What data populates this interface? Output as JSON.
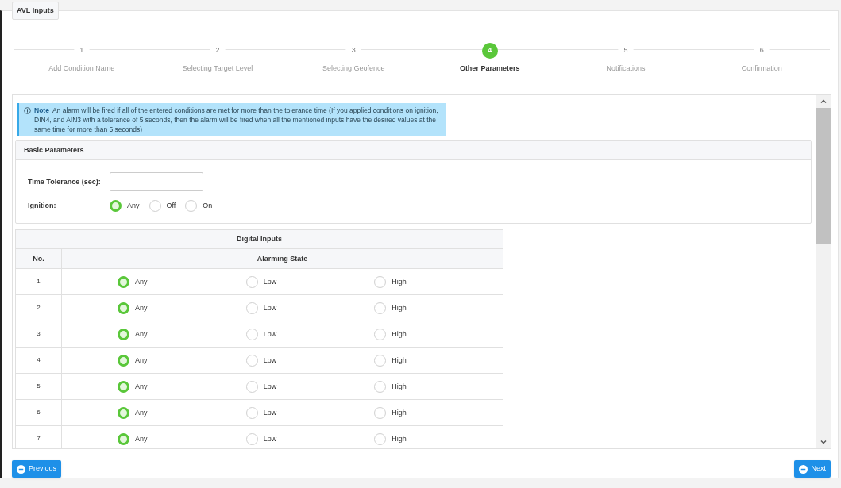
{
  "legend": "AVL Inputs",
  "steps": [
    {
      "number": "1",
      "label": "Add Condition Name",
      "selected": false
    },
    {
      "number": "2",
      "label": "Selecting Target Level",
      "selected": false
    },
    {
      "number": "3",
      "label": "Selecting Geofence",
      "selected": false
    },
    {
      "number": "4",
      "label": "Other Parameters",
      "selected": true
    },
    {
      "number": "5",
      "label": "Notifications",
      "selected": false
    },
    {
      "number": "6",
      "label": "Confirmation",
      "selected": false
    }
  ],
  "note": {
    "title": "Note",
    "text": "An alarm will be fired if all of the entered conditions are met for more than the tolerance time (If you applied conditions on ignition, DIN4, and AIN3 with a tolerance of 5 seconds, then the alarm will be fired when all the mentioned inputs have the desired values at the same time for more than 5 seconds)"
  },
  "basic": {
    "title": "Basic Parameters",
    "tolerance_label": "Time Tolerance (sec):",
    "ignition_label": "Ignition:",
    "ignition_options": [
      {
        "label": "Any",
        "selected": true
      },
      {
        "label": "Off",
        "selected": false
      },
      {
        "label": "On",
        "selected": false
      }
    ]
  },
  "digital": {
    "title": "Digital Inputs",
    "columns": [
      "No.",
      "Alarming State"
    ],
    "rows": [
      {
        "no": "1",
        "options": [
          {
            "label": "Any",
            "selected": true
          },
          {
            "label": "Low",
            "selected": false
          },
          {
            "label": "High",
            "selected": false
          }
        ]
      },
      {
        "no": "2",
        "options": [
          {
            "label": "Any",
            "selected": true
          },
          {
            "label": "Low",
            "selected": false
          },
          {
            "label": "High",
            "selected": false
          }
        ]
      },
      {
        "no": "3",
        "options": [
          {
            "label": "Any",
            "selected": true
          },
          {
            "label": "Low",
            "selected": false
          },
          {
            "label": "High",
            "selected": false
          }
        ]
      },
      {
        "no": "4",
        "options": [
          {
            "label": "Any",
            "selected": true
          },
          {
            "label": "Low",
            "selected": false
          },
          {
            "label": "High",
            "selected": false
          }
        ]
      },
      {
        "no": "5",
        "options": [
          {
            "label": "Any",
            "selected": true
          },
          {
            "label": "Low",
            "selected": false
          },
          {
            "label": "High",
            "selected": false
          }
        ]
      },
      {
        "no": "6",
        "options": [
          {
            "label": "Any",
            "selected": true
          },
          {
            "label": "Low",
            "selected": false
          },
          {
            "label": "High",
            "selected": false
          }
        ]
      },
      {
        "no": "7",
        "options": [
          {
            "label": "Any",
            "selected": true
          },
          {
            "label": "Low",
            "selected": false
          },
          {
            "label": "High",
            "selected": false
          }
        ]
      }
    ]
  },
  "buttons": {
    "previous": "Previous",
    "next": "Next"
  }
}
